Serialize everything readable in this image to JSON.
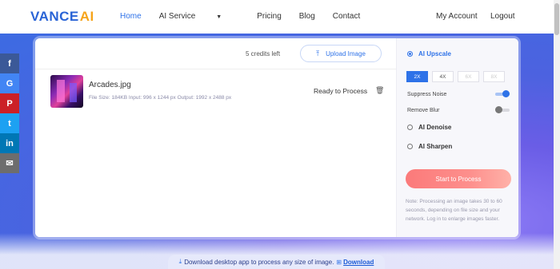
{
  "header": {
    "logo_text": "VANCE",
    "logo_accent": "AI",
    "nav": [
      "Home",
      "AI Service",
      "Pricing",
      "Blog",
      "Contact"
    ],
    "dropdown_caret": "▼",
    "my_account": "My Account",
    "logout": "Logout"
  },
  "social": [
    "f",
    "G",
    "P",
    "t",
    "in",
    "✉"
  ],
  "upload": {
    "credits": "5 credits left",
    "button_label": "Upload Image",
    "upload_icon": "⤒"
  },
  "file": {
    "name": "Arcades.jpg",
    "meta": "File Size: 184KB   Input: 996 x 1244 px   Output: 1992 x 2488 px",
    "status": "Ready to Process",
    "trash_icon": "🗑"
  },
  "options": {
    "upscale": "AI Upscale",
    "scales": [
      "2X",
      "4X",
      "6X",
      "8X"
    ],
    "suppress_noise": "Suppress Noise",
    "remove_blur": "Remove Blur",
    "denoise": "AI Denoise",
    "sharpen": "AI Sharpen",
    "start_button": "Start to Process",
    "note": "Note: Processing an image takes 30 to 60 seconds, depending on file size and your network. Log in to enlarge images faster."
  },
  "bottom": {
    "download_icon": "⤓",
    "text": "Download desktop app to process any size of image.",
    "windows_icon": "⊞",
    "link": "Download"
  },
  "colors": {
    "brand_blue": "#2e72e8",
    "accent_orange": "#f6a41a",
    "start_button": "#fb7a7a"
  }
}
